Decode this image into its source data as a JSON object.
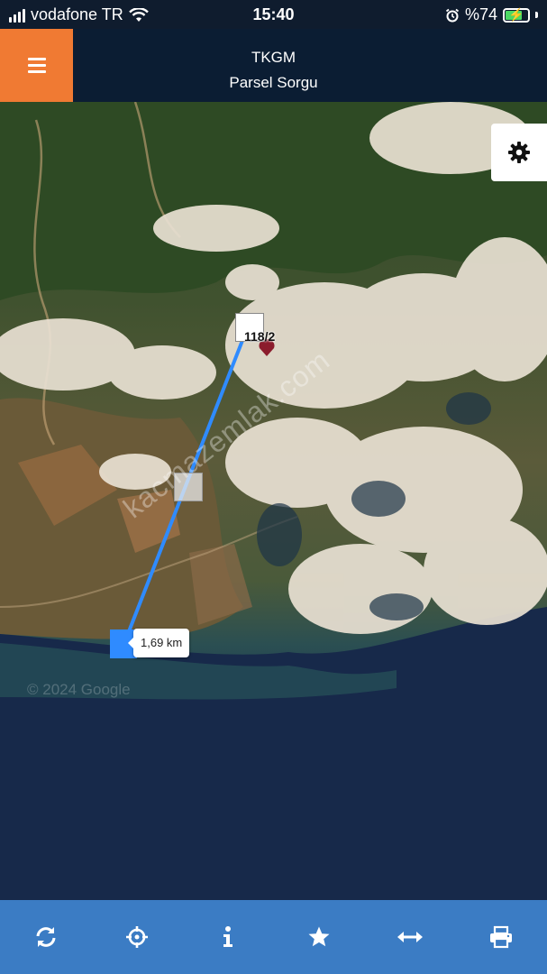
{
  "status_bar": {
    "carrier": "vodafone TR",
    "time": "15:40",
    "battery_percent": "%74",
    "icons": [
      "signal-icon",
      "wifi-icon",
      "alarm-icon",
      "battery-charging-icon"
    ]
  },
  "header": {
    "title": "TKGM",
    "subtitle": "Parsel Sorgu",
    "menu_icon": "hamburger-menu-icon",
    "accent_color": "#f07a33",
    "background_color": "#0b1d33"
  },
  "map": {
    "type": "satellite",
    "parcel_label": "118/2",
    "measurement": {
      "distance_label": "1,69 km"
    },
    "watermark_text": "kacmazemlak.com",
    "copyright_text": "© 2024 Google",
    "settings_icon": "gear-icon",
    "line_color": "#2f8bff"
  },
  "toolbar": {
    "background_color": "#3b7cc4",
    "buttons": [
      {
        "name": "refresh",
        "icon": "refresh-icon"
      },
      {
        "name": "locate",
        "icon": "crosshair-icon"
      },
      {
        "name": "info",
        "icon": "info-icon"
      },
      {
        "name": "favorites",
        "icon": "star-icon"
      },
      {
        "name": "measure",
        "icon": "horizontal-arrows-icon"
      },
      {
        "name": "print",
        "icon": "printer-icon"
      }
    ]
  }
}
